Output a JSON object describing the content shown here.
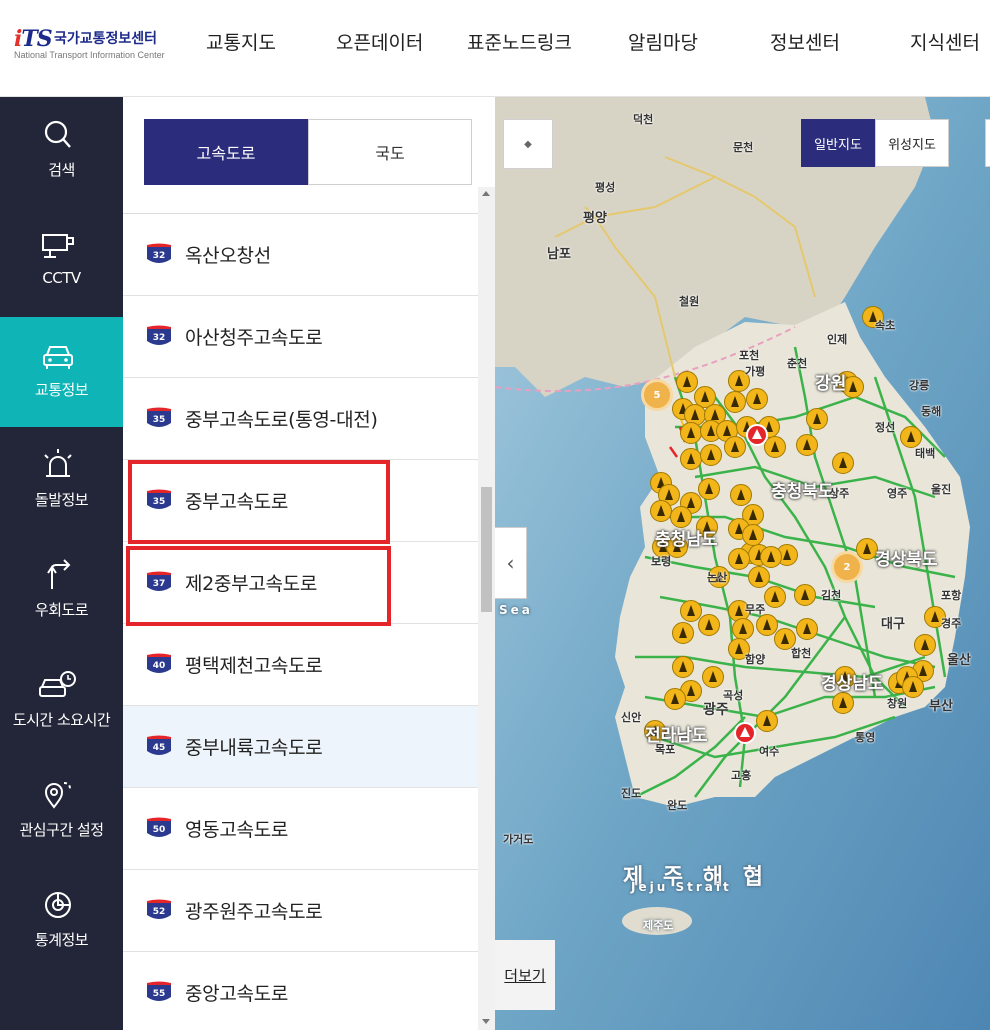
{
  "header": {
    "logo_mark": "iTS",
    "logo_kr": "국가교통정보센터",
    "logo_en": "National Transport Information Center",
    "nav": [
      "교통지도",
      "오픈데이터",
      "표준노드링크",
      "알림마당",
      "정보센터",
      "지식센터"
    ]
  },
  "sidebar": {
    "items": [
      {
        "label": "검색",
        "icon": "search-icon",
        "active": false
      },
      {
        "label": "CCTV",
        "icon": "cctv-icon",
        "active": false
      },
      {
        "label": "교통정보",
        "icon": "car-icon",
        "active": true
      },
      {
        "label": "돌발정보",
        "icon": "alarm-icon",
        "active": false
      },
      {
        "label": "우회도로",
        "icon": "detour-icon",
        "active": false
      },
      {
        "label": "도시간 소요시간",
        "icon": "car-clock-icon",
        "active": false
      },
      {
        "label": "관심구간 설정",
        "icon": "location-pin-icon",
        "active": false
      },
      {
        "label": "통계정보",
        "icon": "chart-icon",
        "active": false
      }
    ],
    "active_color": "#0fb5b6",
    "background": "#232638"
  },
  "panel": {
    "tabs": [
      {
        "label": "고속도로",
        "active": true
      },
      {
        "label": "국도",
        "active": false
      }
    ],
    "routes": [
      {
        "number": "32",
        "name": "옥산오창선",
        "selected": false,
        "highlighted": false
      },
      {
        "number": "32",
        "name": "아산청주고속도로",
        "selected": false,
        "highlighted": false
      },
      {
        "number": "35",
        "name": "중부고속도로(통영-대전)",
        "selected": false,
        "highlighted": false
      },
      {
        "number": "35",
        "name": "중부고속도로",
        "selected": false,
        "highlighted": true
      },
      {
        "number": "37",
        "name": "제2중부고속도로",
        "selected": false,
        "highlighted": true
      },
      {
        "number": "40",
        "name": "평택제천고속도로",
        "selected": false,
        "highlighted": false
      },
      {
        "number": "45",
        "name": "중부내륙고속도로",
        "selected": true,
        "highlighted": false
      },
      {
        "number": "50",
        "name": "영동고속도로",
        "selected": false,
        "highlighted": false
      },
      {
        "number": "52",
        "name": "광주원주고속도로",
        "selected": false,
        "highlighted": false
      },
      {
        "number": "55",
        "name": "중앙고속도로",
        "selected": false,
        "highlighted": false
      }
    ],
    "tab_active_color": "#2b2d7c",
    "highlight_color": "#e4262b"
  },
  "map": {
    "view_toggle": [
      {
        "label": "일반지도",
        "active": true
      },
      {
        "label": "위성지도",
        "active": false
      }
    ],
    "more_link": "더보기",
    "cluster_counts": [
      "5",
      "2"
    ],
    "place_labels": {
      "덕천": "덕천",
      "문천": "문천",
      "평성": "평성",
      "평양": "평양",
      "남포": "남포",
      "철원": "철원",
      "인제": "인제",
      "속초": "속초",
      "포천": "포천",
      "가평": "가평",
      "춘천": "춘천",
      "강릉": "강릉",
      "동해": "동해",
      "정선": "정선",
      "태백": "태백",
      "상주": "상주",
      "영주": "영주",
      "울진": "울진",
      "김천": "김천",
      "포항": "포항",
      "대구": "대구",
      "경주": "경주",
      "울산": "울산",
      "창원": "창원",
      "부산": "부산",
      "통영": "통영",
      "여수": "여수",
      "광주": "광주",
      "목포": "목포",
      "신안": "신안",
      "진도": "진도",
      "완도": "완도",
      "고흥": "고흥",
      "보령": "보령",
      "논산": "논산",
      "무주": "무주",
      "함양": "함양",
      "합천": "합천",
      "곡성": "곡성",
      "가거도": "가거도",
      "제주도": "제주도"
    },
    "region_labels": [
      "강원",
      "충청북도",
      "충청남도",
      "경상북도",
      "전라남도",
      "경상남도"
    ],
    "sea_label": "제 주 해 협",
    "sea_label_en": "Jeju Strait",
    "sea_partial": "Sea",
    "incident_color": "#e4262b",
    "marker_color": "#f2b51a"
  }
}
